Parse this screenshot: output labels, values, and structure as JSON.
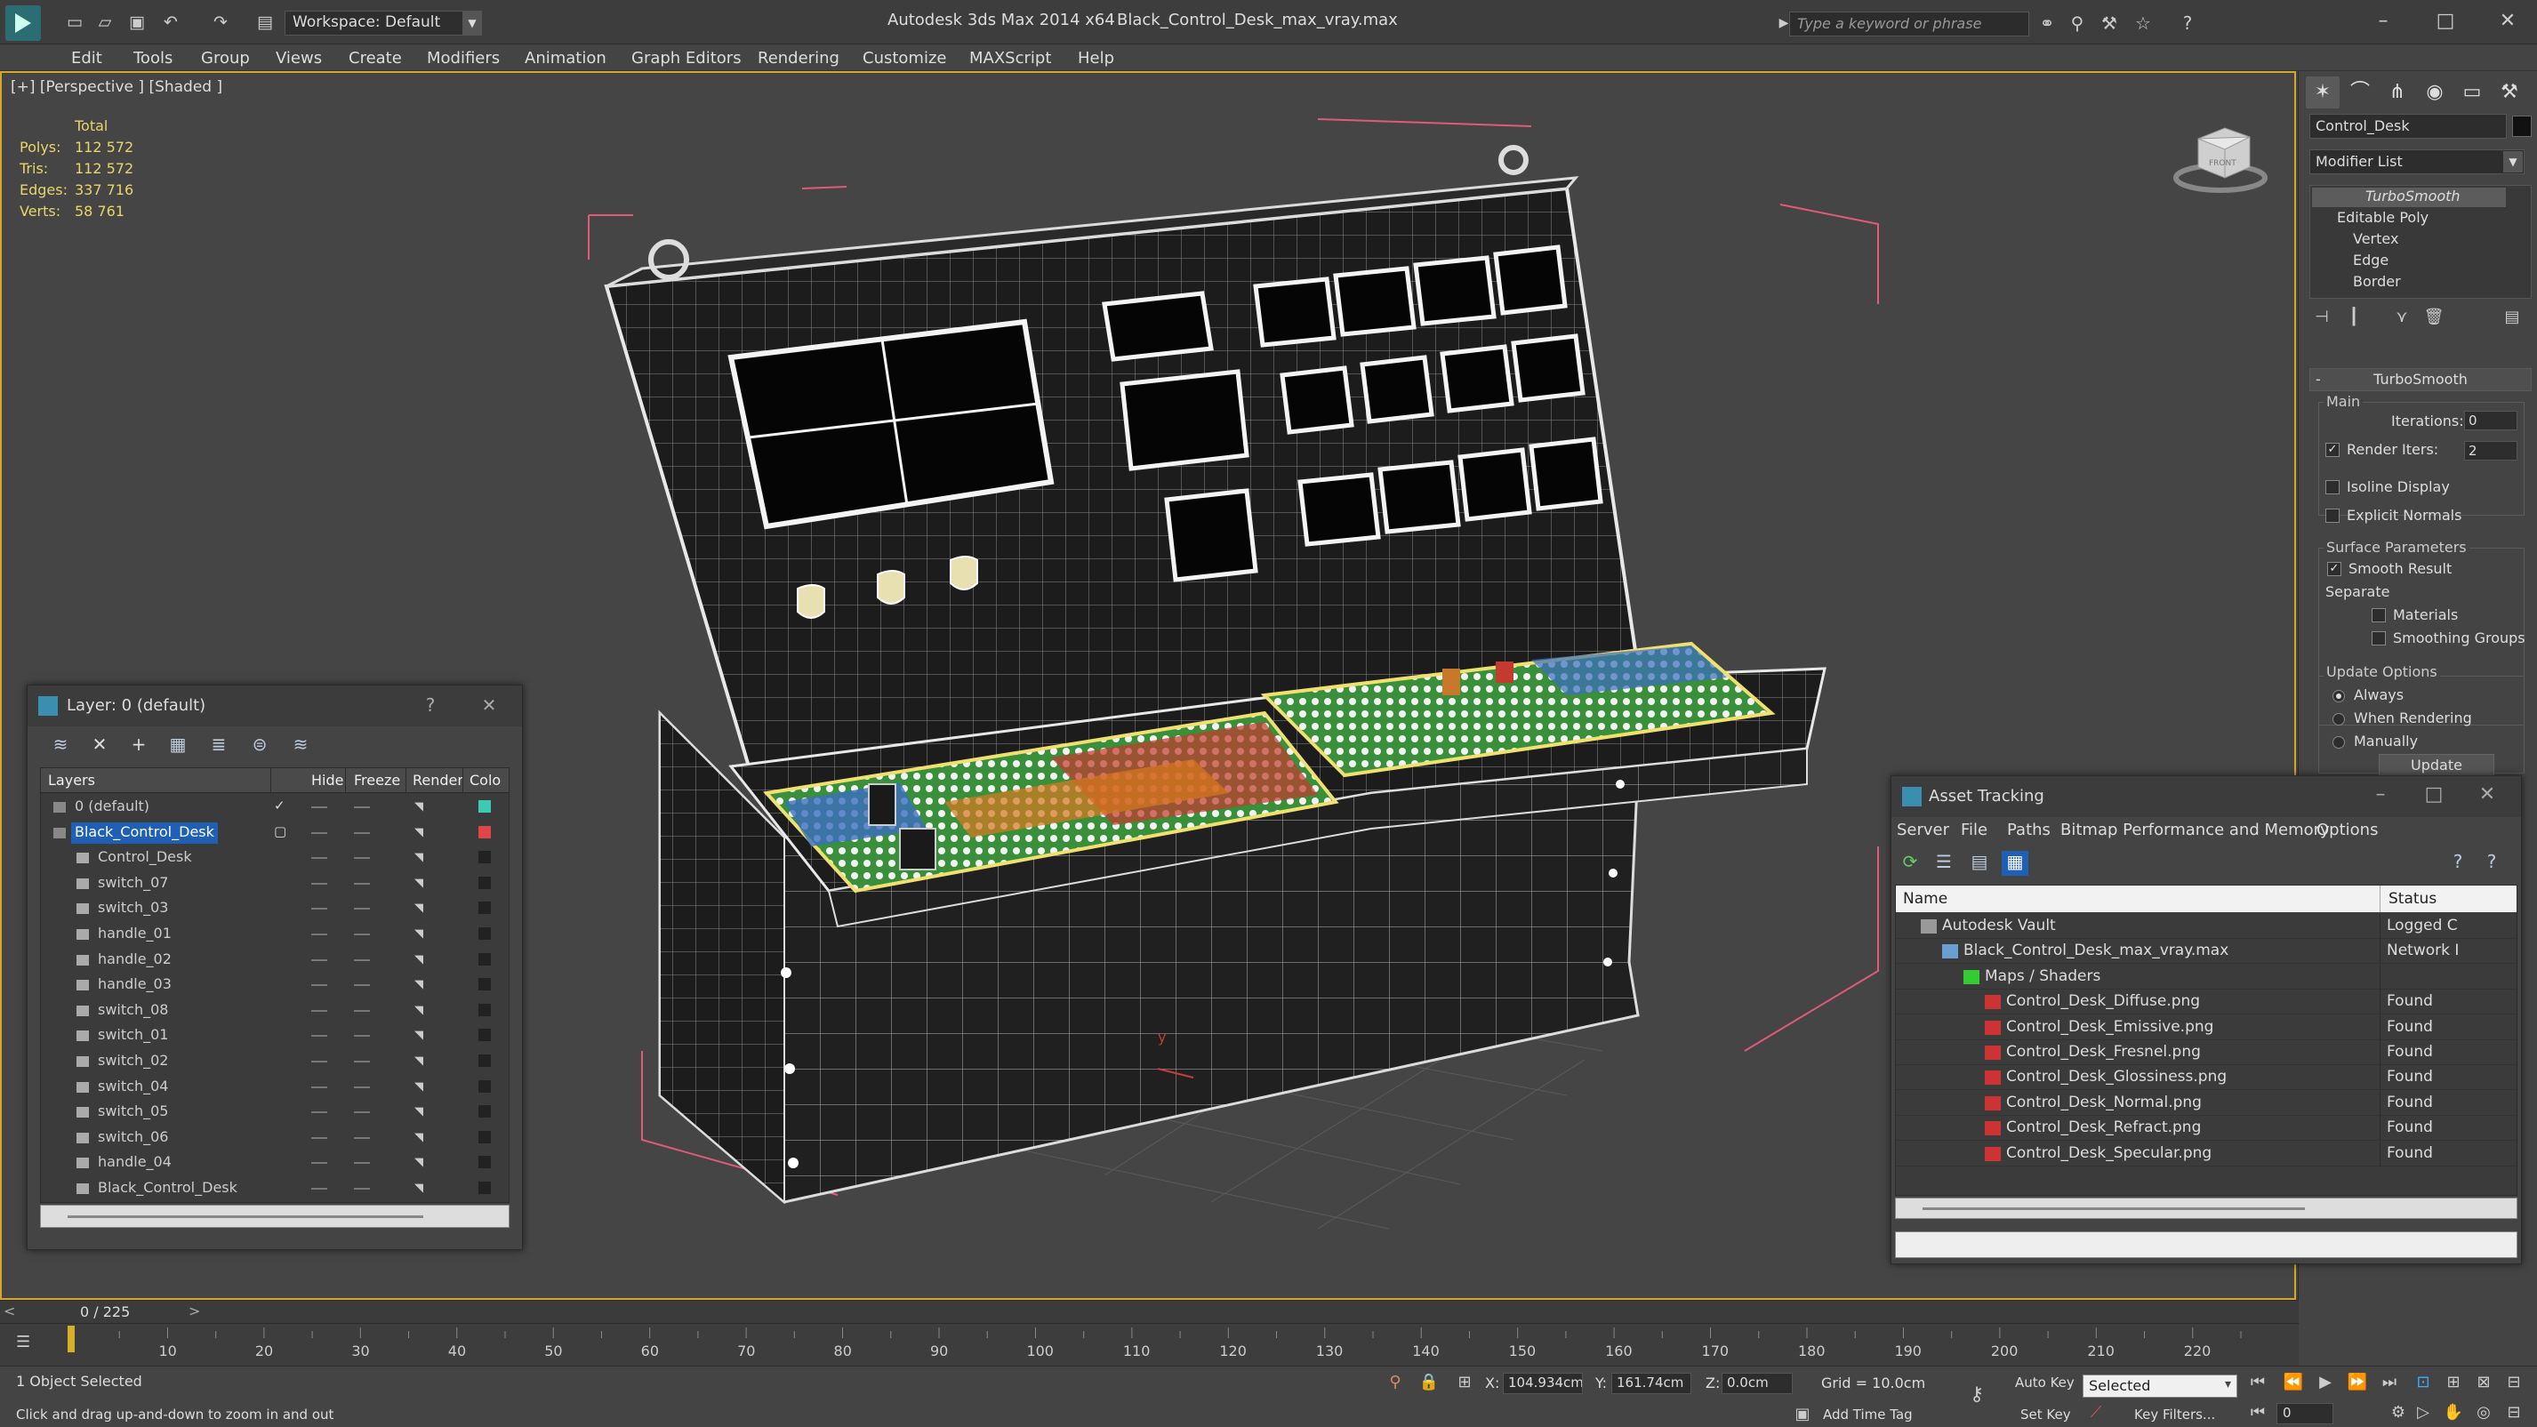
{
  "titlebar": {
    "workspace_label": "Workspace: Default",
    "app_title": "Autodesk 3ds Max  2014 x64",
    "file_title": "Black_Control_Desk_max_vray.max",
    "search_placeholder": "Type a keyword or phrase"
  },
  "menu": [
    "Edit",
    "Tools",
    "Group",
    "Views",
    "Create",
    "Modifiers",
    "Animation",
    "Graph Editors",
    "Rendering",
    "Customize",
    "MAXScript",
    "Help"
  ],
  "viewport": {
    "label": "[+] [Perspective ] [Shaded ]",
    "stats_header": "Total",
    "stats": [
      {
        "label": "Polys:",
        "value": "112 572"
      },
      {
        "label": "Tris:",
        "value": "112 572"
      },
      {
        "label": "Edges:",
        "value": "337 716"
      },
      {
        "label": "Verts:",
        "value": "58 761"
      }
    ],
    "viewcube_label": "FRONT"
  },
  "command_panel": {
    "object_name": "Control_Desk",
    "modifier_list": "Modifier List",
    "stack": [
      "TurboSmooth",
      "Editable Poly",
      "Vertex",
      "Edge",
      "Border"
    ],
    "rollout_title": "TurboSmooth",
    "main_label": "Main",
    "iterations_label": "Iterations:",
    "iterations_value": "0",
    "render_iters_label": "Render Iters:",
    "render_iters_value": "2",
    "isoline_label": "Isoline Display",
    "explicit_normals_label": "Explicit Normals",
    "surface_params_label": "Surface Parameters",
    "smooth_result_label": "Smooth Result",
    "separate_label": "Separate",
    "materials_label": "Materials",
    "smoothing_groups_label": "Smoothing Groups",
    "update_options_label": "Update Options",
    "always_label": "Always",
    "when_rendering_label": "When Rendering",
    "manually_label": "Manually",
    "update_button": "Update"
  },
  "layer_window": {
    "title": "Layer: 0 (default)",
    "columns": [
      "Layers",
      "Hide",
      "Freeze",
      "Render",
      "Colo"
    ],
    "rows": [
      {
        "name": "0 (default)",
        "indent": 0,
        "color": "#3fc8b4",
        "selected": false,
        "checked": true
      },
      {
        "name": "Black_Control_Desk",
        "indent": 0,
        "color": "#e0454a",
        "selected": true,
        "checked": false
      },
      {
        "name": "Control_Desk",
        "indent": 1,
        "color": "#222222",
        "selected": false,
        "checked": false
      },
      {
        "name": "switch_07",
        "indent": 1,
        "color": "#222222",
        "selected": false,
        "checked": false
      },
      {
        "name": "switch_03",
        "indent": 1,
        "color": "#222222",
        "selected": false,
        "checked": false
      },
      {
        "name": "handle_01",
        "indent": 1,
        "color": "#222222",
        "selected": false,
        "checked": false
      },
      {
        "name": "handle_02",
        "indent": 1,
        "color": "#222222",
        "selected": false,
        "checked": false
      },
      {
        "name": "handle_03",
        "indent": 1,
        "color": "#222222",
        "selected": false,
        "checked": false
      },
      {
        "name": "switch_08",
        "indent": 1,
        "color": "#222222",
        "selected": false,
        "checked": false
      },
      {
        "name": "switch_01",
        "indent": 1,
        "color": "#222222",
        "selected": false,
        "checked": false
      },
      {
        "name": "switch_02",
        "indent": 1,
        "color": "#222222",
        "selected": false,
        "checked": false
      },
      {
        "name": "switch_04",
        "indent": 1,
        "color": "#222222",
        "selected": false,
        "checked": false
      },
      {
        "name": "switch_05",
        "indent": 1,
        "color": "#222222",
        "selected": false,
        "checked": false
      },
      {
        "name": "switch_06",
        "indent": 1,
        "color": "#222222",
        "selected": false,
        "checked": false
      },
      {
        "name": "handle_04",
        "indent": 1,
        "color": "#222222",
        "selected": false,
        "checked": false
      },
      {
        "name": "Black_Control_Desk",
        "indent": 1,
        "color": "#222222",
        "selected": false,
        "checked": false
      }
    ]
  },
  "asset_window": {
    "title": "Asset Tracking",
    "menu": [
      "Server",
      "File",
      "Paths",
      "Bitmap Performance and Memory",
      "Options"
    ],
    "columns": [
      "Name",
      "Status"
    ],
    "rows": [
      {
        "name": "Autodesk Vault",
        "indent": 0,
        "status": "Logged C",
        "type": "vault"
      },
      {
        "name": "Black_Control_Desk_max_vray.max",
        "indent": 1,
        "status": "Network I",
        "type": "max"
      },
      {
        "name": "Maps / Shaders",
        "indent": 2,
        "status": "",
        "type": "folder"
      },
      {
        "name": "Control_Desk_Diffuse.png",
        "indent": 3,
        "status": "Found",
        "type": "png"
      },
      {
        "name": "Control_Desk_Emissive.png",
        "indent": 3,
        "status": "Found",
        "type": "png"
      },
      {
        "name": "Control_Desk_Fresnel.png",
        "indent": 3,
        "status": "Found",
        "type": "png"
      },
      {
        "name": "Control_Desk_Glossiness.png",
        "indent": 3,
        "status": "Found",
        "type": "png"
      },
      {
        "name": "Control_Desk_Normal.png",
        "indent": 3,
        "status": "Found",
        "type": "png"
      },
      {
        "name": "Control_Desk_Refract.png",
        "indent": 3,
        "status": "Found",
        "type": "png"
      },
      {
        "name": "Control_Desk_Specular.png",
        "indent": 3,
        "status": "Found",
        "type": "png"
      }
    ]
  },
  "timeline": {
    "frame_label": "0 / 225",
    "ticks": [
      10,
      20,
      30,
      40,
      50,
      60,
      70,
      80,
      90,
      100,
      110,
      120,
      130,
      140,
      150,
      160,
      170,
      180,
      190,
      200,
      210,
      220
    ],
    "max_frame": 225
  },
  "status": {
    "selection": "1 Object Selected",
    "hint": "Click and drag up-and-down to zoom in and out",
    "x_label": "X:",
    "x_value": "104.934cm",
    "y_label": "Y:",
    "y_value": "161.74cm",
    "z_label": "Z:",
    "z_value": "0.0cm",
    "grid": "Grid = 10.0cm",
    "add_time_tag": "Add Time Tag",
    "auto_key": "Auto Key",
    "set_key": "Set Key",
    "selected_option": "Selected",
    "key_filters": "Key Filters...",
    "frame_value": "0"
  }
}
